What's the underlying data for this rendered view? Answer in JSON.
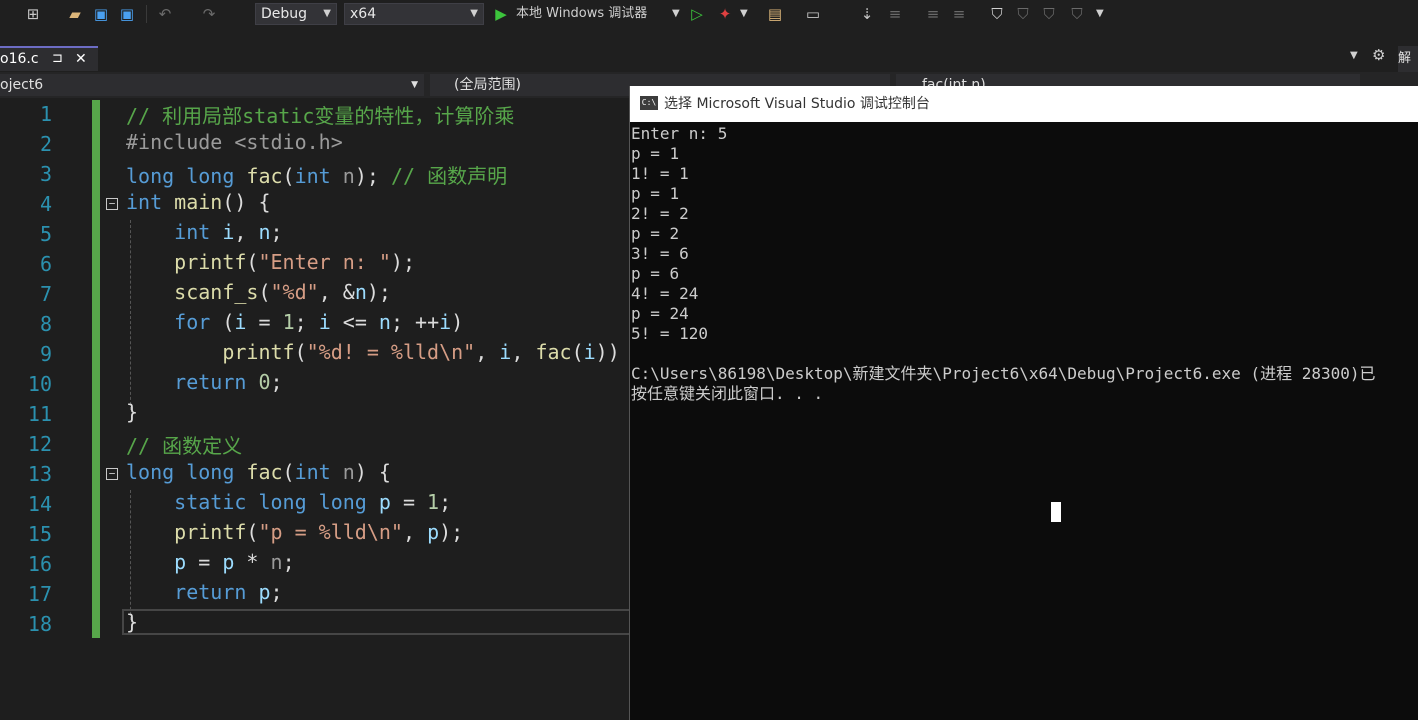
{
  "toolbar": {
    "config": "Debug",
    "platform": "x64",
    "run_label": "本地 Windows 调试器"
  },
  "tab": {
    "name": "o16.c",
    "pin": "⊐",
    "close": "✕"
  },
  "navbar": {
    "project": "oject6",
    "scope": "(全局范围)",
    "member": "fac(int n)"
  },
  "right_panel": {
    "label": "解"
  },
  "editor": {
    "line_numbers": [
      "1",
      "2",
      "3",
      "4",
      "5",
      "6",
      "7",
      "8",
      "9",
      "10",
      "11",
      "12",
      "13",
      "14",
      "15",
      "16",
      "17",
      "18"
    ]
  },
  "console": {
    "title": "选择 Microsoft Visual Studio 调试控制台",
    "icon_text": "C:\\",
    "output": "Enter n: 5\np = 1\n1! = 1\np = 1\n2! = 2\np = 2\n3! = 6\np = 6\n4! = 24\np = 24\n5! = 120\n\nC:\\Users\\86198\\Desktop\\新建文件夹\\Project6\\x64\\Debug\\Project6.exe (进程 28300)已\n按任意键关闭此窗口. . ."
  }
}
